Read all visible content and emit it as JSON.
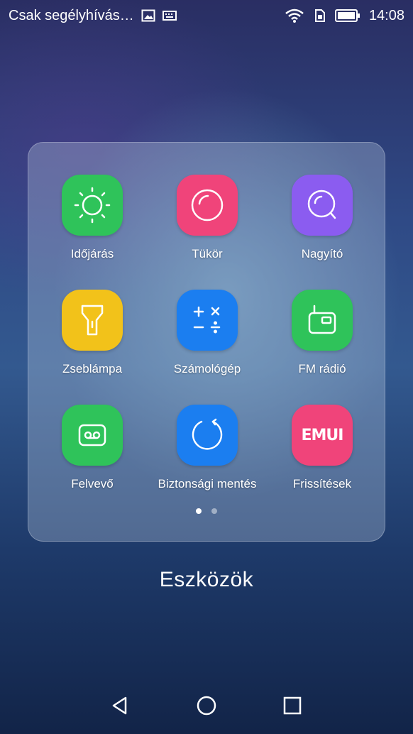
{
  "status_bar": {
    "carrier_text": "Csak segélyhívás…",
    "time": "14:08",
    "icons": [
      "image-icon",
      "keyboard-icon",
      "wifi-icon",
      "sim-icon",
      "battery-icon"
    ]
  },
  "folder": {
    "title": "Eszközök",
    "apps": [
      {
        "label": "Időjárás",
        "icon": "sun-icon",
        "color": "#2fc35a"
      },
      {
        "label": "Tükör",
        "icon": "mirror-icon",
        "color": "#f0447a"
      },
      {
        "label": "Nagyító",
        "icon": "magnifier-icon",
        "color": "#8b5cf0"
      },
      {
        "label": "Zseblámpa",
        "icon": "flashlight-icon",
        "color": "#f2c21a"
      },
      {
        "label": "Számológép",
        "icon": "calculator-icon",
        "color": "#1b7ef0"
      },
      {
        "label": "FM rádió",
        "icon": "radio-icon",
        "color": "#2fc35a"
      },
      {
        "label": "Felvevő",
        "icon": "recorder-icon",
        "color": "#2fc35a"
      },
      {
        "label": "Biztonsági mentés",
        "icon": "backup-icon",
        "color": "#1b7ef0"
      },
      {
        "label": "Frissítések",
        "icon": "emui-icon",
        "color": "#f0447a",
        "icon_text": "EMUI"
      }
    ],
    "page_indicator": {
      "pages": 2,
      "current": 1
    }
  },
  "nav_bar": {
    "buttons": [
      "back-icon",
      "home-icon",
      "recents-icon"
    ]
  }
}
